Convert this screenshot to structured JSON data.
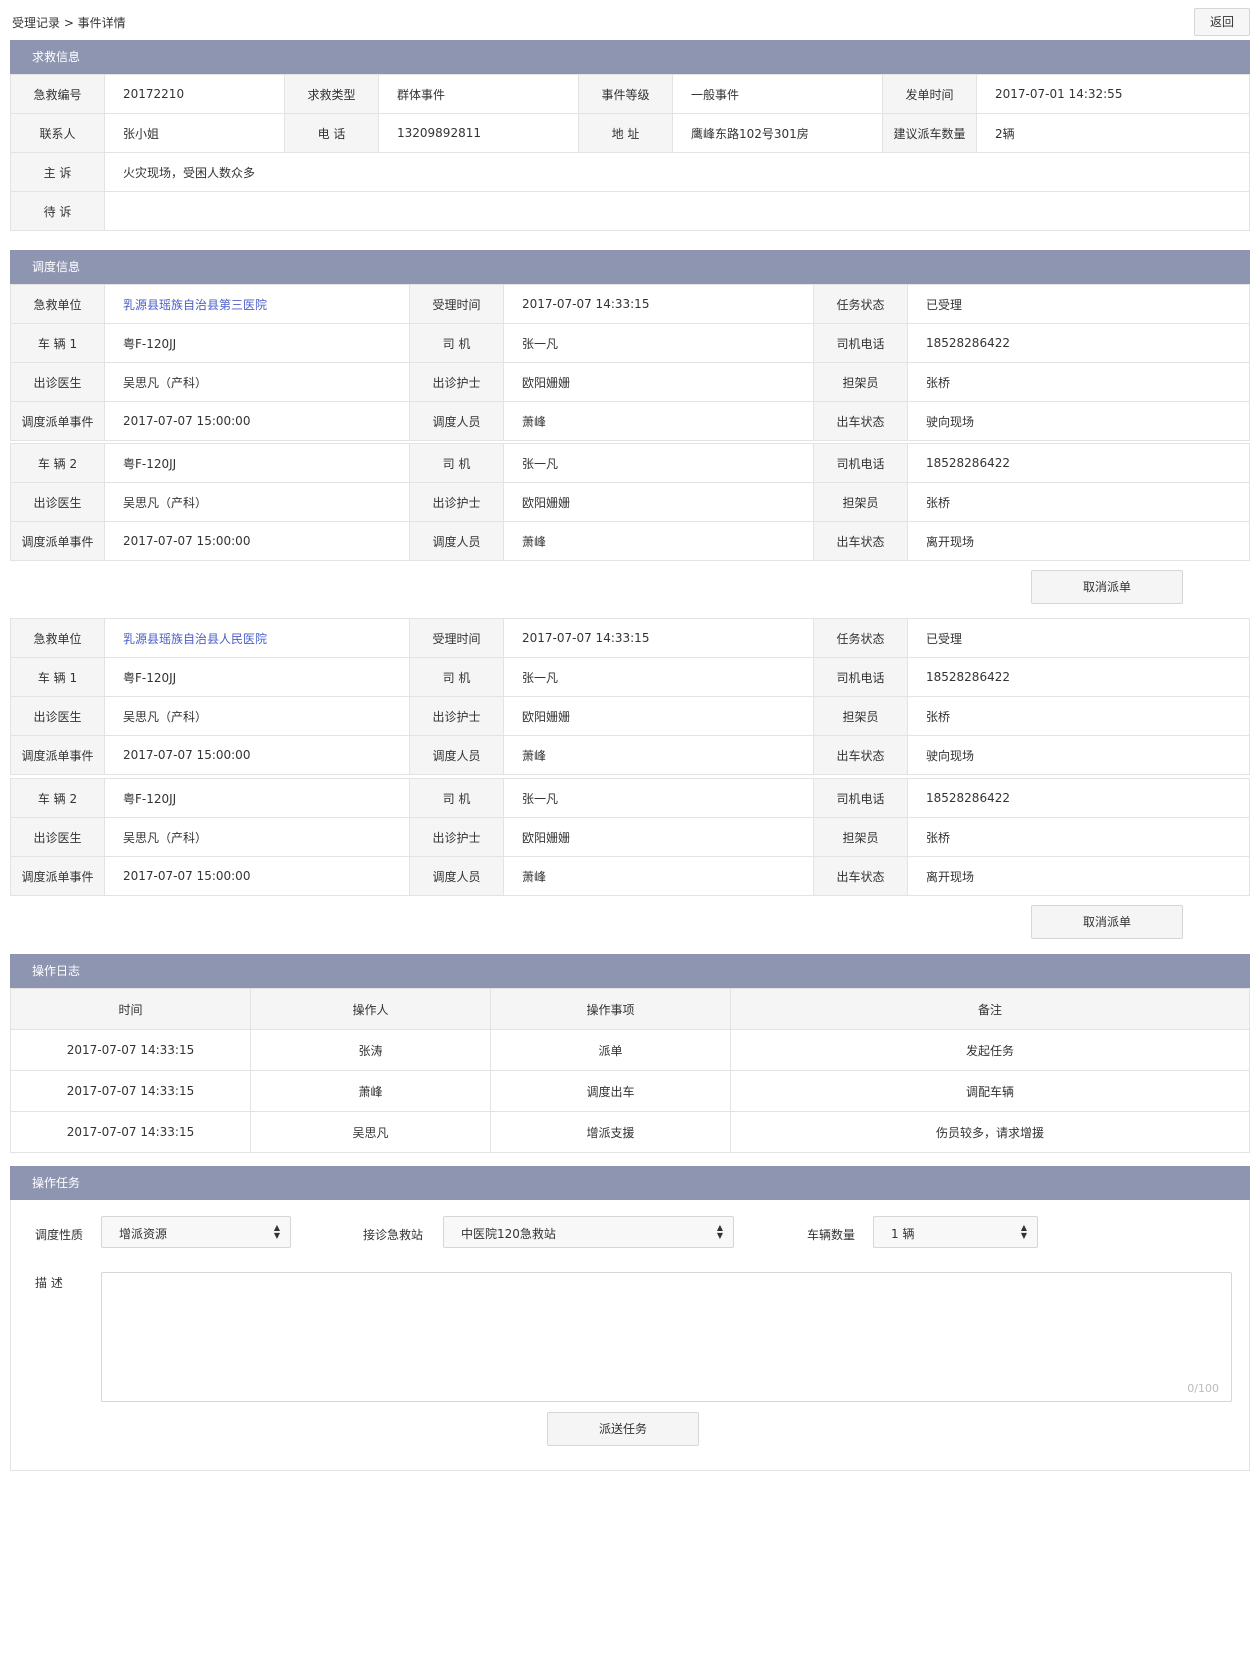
{
  "header": {
    "breadcrumb": "受理记录 > 事件详情",
    "back_label": "返回"
  },
  "rescue": {
    "title": "求救信息",
    "row1": [
      "急救编号",
      "20172210",
      "求救类型",
      "群体事件",
      "事件等级",
      "一般事件",
      "发单时间",
      "2017-07-01  14:32:55"
    ],
    "row2": [
      "联系人",
      "张小姐",
      "电  话",
      "13209892811",
      "地  址",
      "鹰峰东路102号301房",
      "建议派车数量",
      "2辆"
    ],
    "complaint_label": "主  诉",
    "complaint": "火灾现场，受困人数众多",
    "pending_label": "待  诉",
    "pending": ""
  },
  "dispatch": {
    "title": "调度信息",
    "cancel_label": "取消派单",
    "groups": [
      {
        "unit_label": "急救单位",
        "unit": "乳源县瑶族自治县第三医院",
        "accept_label": "受理时间",
        "accept_time": "2017-07-07  14:33:15",
        "status_label": "任务状态",
        "status": "已受理",
        "vehicles": [
          {
            "vehicle_label": "车  辆 1",
            "plate": "粤F-120JJ",
            "driver_label": "司  机",
            "driver": "张一凡",
            "phone_label": "司机电话",
            "phone": "18528286422",
            "doctor_label": "出诊医生",
            "doctor": "吴思凡（产科）",
            "nurse_label": "出诊护士",
            "nurse": "欧阳姗姗",
            "stretcher_label": "担架员",
            "stretcher": "张桥",
            "event_label": "调度派单事件",
            "event_time": "2017-07-07  15:00:00",
            "dispatcher_label": "调度人员",
            "dispatcher": "萧峰",
            "car_status_label": "出车状态",
            "car_status": "驶向现场"
          },
          {
            "vehicle_label": "车  辆 2",
            "plate": "粤F-120JJ",
            "driver_label": "司  机",
            "driver": "张一凡",
            "phone_label": "司机电话",
            "phone": "18528286422",
            "doctor_label": "出诊医生",
            "doctor": "吴思凡（产科）",
            "nurse_label": "出诊护士",
            "nurse": "欧阳姗姗",
            "stretcher_label": "担架员",
            "stretcher": "张桥",
            "event_label": "调度派单事件",
            "event_time": "2017-07-07  15:00:00",
            "dispatcher_label": "调度人员",
            "dispatcher": "萧峰",
            "car_status_label": "出车状态",
            "car_status": "离开现场"
          }
        ]
      },
      {
        "unit_label": "急救单位",
        "unit": "乳源县瑶族自治县人民医院",
        "accept_label": "受理时间",
        "accept_time": "2017-07-07  14:33:15",
        "status_label": "任务状态",
        "status": "已受理",
        "vehicles": [
          {
            "vehicle_label": "车  辆 1",
            "plate": "粤F-120JJ",
            "driver_label": "司  机",
            "driver": "张一凡",
            "phone_label": "司机电话",
            "phone": "18528286422",
            "doctor_label": "出诊医生",
            "doctor": "吴思凡（产科）",
            "nurse_label": "出诊护士",
            "nurse": "欧阳姗姗",
            "stretcher_label": "担架员",
            "stretcher": "张桥",
            "event_label": "调度派单事件",
            "event_time": "2017-07-07  15:00:00",
            "dispatcher_label": "调度人员",
            "dispatcher": "萧峰",
            "car_status_label": "出车状态",
            "car_status": "驶向现场"
          },
          {
            "vehicle_label": "车  辆 2",
            "plate": "粤F-120JJ",
            "driver_label": "司  机",
            "driver": "张一凡",
            "phone_label": "司机电话",
            "phone": "18528286422",
            "doctor_label": "出诊医生",
            "doctor": "吴思凡（产科）",
            "nurse_label": "出诊护士",
            "nurse": "欧阳姗姗",
            "stretcher_label": "担架员",
            "stretcher": "张桥",
            "event_label": "调度派单事件",
            "event_time": "2017-07-07  15:00:00",
            "dispatcher_label": "调度人员",
            "dispatcher": "萧峰",
            "car_status_label": "出车状态",
            "car_status": "离开现场"
          }
        ]
      }
    ]
  },
  "log": {
    "title": "操作日志",
    "headers": [
      "时间",
      "操作人",
      "操作事项",
      "备注"
    ],
    "rows": [
      [
        "2017-07-07  14:33:15",
        "张涛",
        "派单",
        "发起任务"
      ],
      [
        "2017-07-07  14:33:15",
        "萧峰",
        "调度出车",
        "调配车辆"
      ],
      [
        "2017-07-07  14:33:15",
        "吴思凡",
        "增派支援",
        "伤员较多，请求增援"
      ]
    ]
  },
  "task": {
    "title": "操作任务",
    "nature_label": "调度性质",
    "nature_value": "增派资源",
    "station_label": "接诊急救站",
    "station_value": "中医院120急救站",
    "count_label": "车辆数量",
    "count_value": "1 辆",
    "desc_label": "描  述",
    "desc_counter": "0/100",
    "send_label": "派送任务"
  },
  "colors": {
    "section_header": "#8d95b0",
    "link": "#4a5ec9"
  }
}
